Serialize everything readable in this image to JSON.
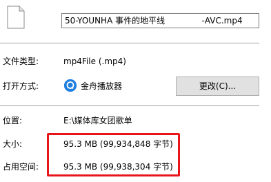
{
  "general": {
    "filename": "50-YOUNHA 事件的地平线              -AVC.mp4",
    "rows": {
      "file_type": {
        "label": "文件类型:",
        "value": "mp4File (.mp4)"
      },
      "opens_with": {
        "label": "打开方式:",
        "app_name": "金舟播放器",
        "change_button": "更改(C)...",
        "app_icon_color": "#1f7fe0"
      },
      "location": {
        "label": "位置:",
        "value": "E:\\媒体库女团歌单"
      },
      "size": {
        "label": "大小:",
        "value": "95.3 MB (99,934,848 字节)"
      },
      "size_on_disk": {
        "label": "占用空间:",
        "value": "95.3 MB (99,938,304 字节)"
      }
    },
    "highlight_color": "#e8161b"
  }
}
